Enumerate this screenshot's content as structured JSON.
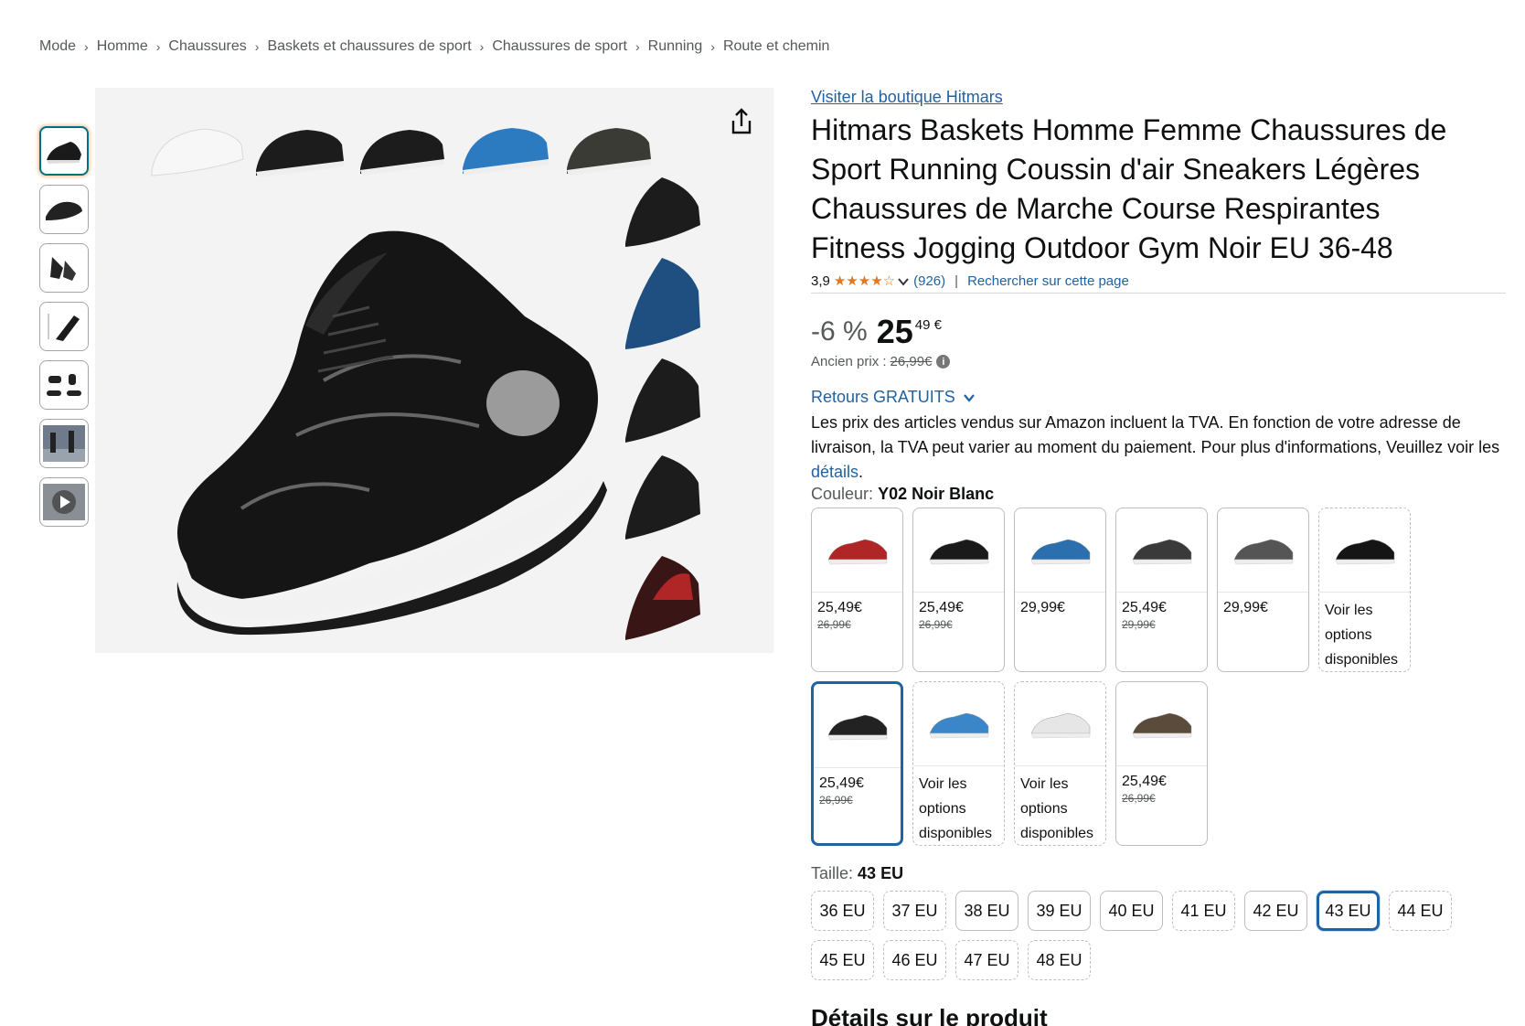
{
  "breadcrumb": [
    "Mode",
    "Homme",
    "Chaussures",
    "Baskets et chaussures de sport",
    "Chaussures de sport",
    "Running",
    "Route et chemin"
  ],
  "product": {
    "store_link": "Visiter la boutique Hitmars",
    "title": "Hitmars Baskets Homme Femme Chaussures de Sport Running Coussin d'air Sneakers Légères Chaussures de Marche Course Respirantes Fitness Jogging Outdoor Gym Noir EU 36-48",
    "rating_value": "3,9",
    "rating_stars": 3.9,
    "rating_count": "(926)",
    "search_page": "Rechercher sur cette page"
  },
  "price": {
    "discount": "-6 %",
    "whole": "25",
    "fraction": "49 €",
    "old_label": "Ancien prix :",
    "old_value": "26,99€"
  },
  "returns": {
    "label": "Retours GRATUITS",
    "vat_text": "Les prix des articles vendus sur Amazon incluent la TVA. En fonction de votre adresse de livraison, la TVA peut varier au moment du paiement. Pour plus d'informations, Veuillez voir les ",
    "details_link": "détails",
    "vat_end": "."
  },
  "color": {
    "label": "Couleur:",
    "selected": "Y02 Noir Blanc",
    "swatches": [
      {
        "price": "25,49€",
        "old": "26,99€",
        "shoe": "#b02525"
      },
      {
        "price": "25,49€",
        "old": "26,99€",
        "shoe": "#1a1a1a"
      },
      {
        "price": "29,99€",
        "old": "",
        "shoe": "#2c6fae"
      },
      {
        "price": "25,49€",
        "old": "29,99€",
        "shoe": "#3a3a3a"
      },
      {
        "price": "29,99€",
        "old": "",
        "shoe": "#555555"
      },
      {
        "options": "Voir les options disponibles",
        "shoe": "#151515"
      },
      {
        "price": "25,49€",
        "old": "26,99€",
        "shoe": "#222222",
        "selected": true
      },
      {
        "options": "Voir les options disponibles",
        "shoe": "#3a86c8"
      },
      {
        "options": "Voir les options disponibles",
        "shoe": "#e6e6e6"
      },
      {
        "price": "25,49€",
        "old": "26,99€",
        "shoe": "#5a4b3a"
      }
    ]
  },
  "size": {
    "label": "Taille:",
    "selected": "43 EU",
    "options": [
      "36 EU",
      "37 EU",
      "38 EU",
      "39 EU",
      "40 EU",
      "41 EU",
      "42 EU",
      "43 EU",
      "44 EU",
      "45 EU",
      "46 EU",
      "47 EU",
      "48 EU"
    ]
  },
  "details_heading": "Détails sur le produit"
}
